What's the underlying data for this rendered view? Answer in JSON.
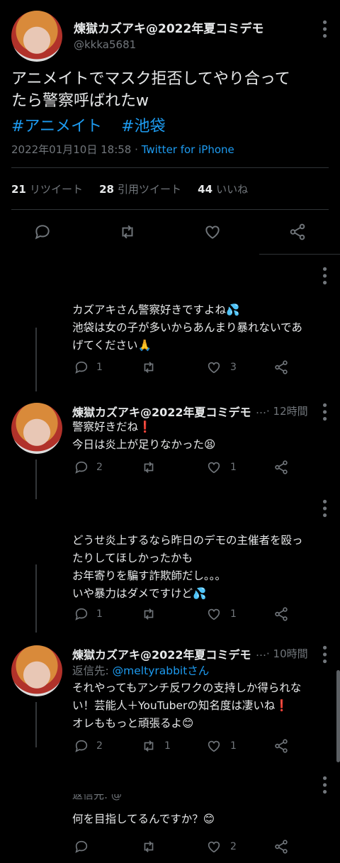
{
  "author": {
    "name": "煉獄カズアキ@2022年夏コミデモ",
    "handle": "@kkka5681"
  },
  "tweet": {
    "text_line1": "アニメイトでマスク拒否してやり合って",
    "text_line2": "たら警察呼ばれたw",
    "hashtag1": "#アニメイト",
    "hashtag2": "#池袋",
    "date": "2022年01月10日 18:58",
    "sep": "·",
    "source": "Twitter for iPhone",
    "retweets_count": "21",
    "retweets_label": "リツイート",
    "quotes_count": "28",
    "quotes_label": "引用ツイート",
    "likes_count": "44",
    "likes_label": "いいね"
  },
  "replies": [
    {
      "lines": [
        "カズアキさん警察好きですよね💦",
        "池袋は女の子が多いからあんまり暴れないであ",
        "げてください🙏"
      ],
      "reply_count": "1",
      "retweet_count": "",
      "like_count": "3"
    },
    {
      "name": "煉獄カズアキ@2022年夏コミデモ",
      "ellipsis": "…",
      "time": "· 12時間",
      "lines": [
        "警察好きだね❗",
        "今日は炎上が足りなかった😫"
      ],
      "reply_count": "2",
      "retweet_count": "",
      "like_count": "1"
    },
    {
      "lines": [
        "どうせ炎上するなら昨日のデモの主催者を殴っ",
        "たりしてほしかったかも",
        "お年寄りを騙す詐欺師だし。。。",
        "いや暴力はダメですけど💦"
      ],
      "reply_count": "1",
      "retweet_count": "",
      "like_count": "1"
    },
    {
      "name": "煉獄カズアキ@2022年夏コミデモ",
      "ellipsis": "…",
      "time": "· 10時間",
      "reply_to_label": "返信先:",
      "reply_to_user": "@meltyrabbitさん",
      "lines": [
        "それやってもアンチ反ワクの支持しか得られな",
        "い！芸能人＋YouTuberの知名度は凄いね❗",
        "オレももっと頑張るよ😊"
      ],
      "reply_count": "2",
      "retweet_count": "1",
      "like_count": "1"
    },
    {
      "partial": "返信先: @",
      "lines": [
        "何を目指してるんですか？😊"
      ],
      "reply_count": "",
      "retweet_count": "",
      "like_count": "2"
    }
  ]
}
